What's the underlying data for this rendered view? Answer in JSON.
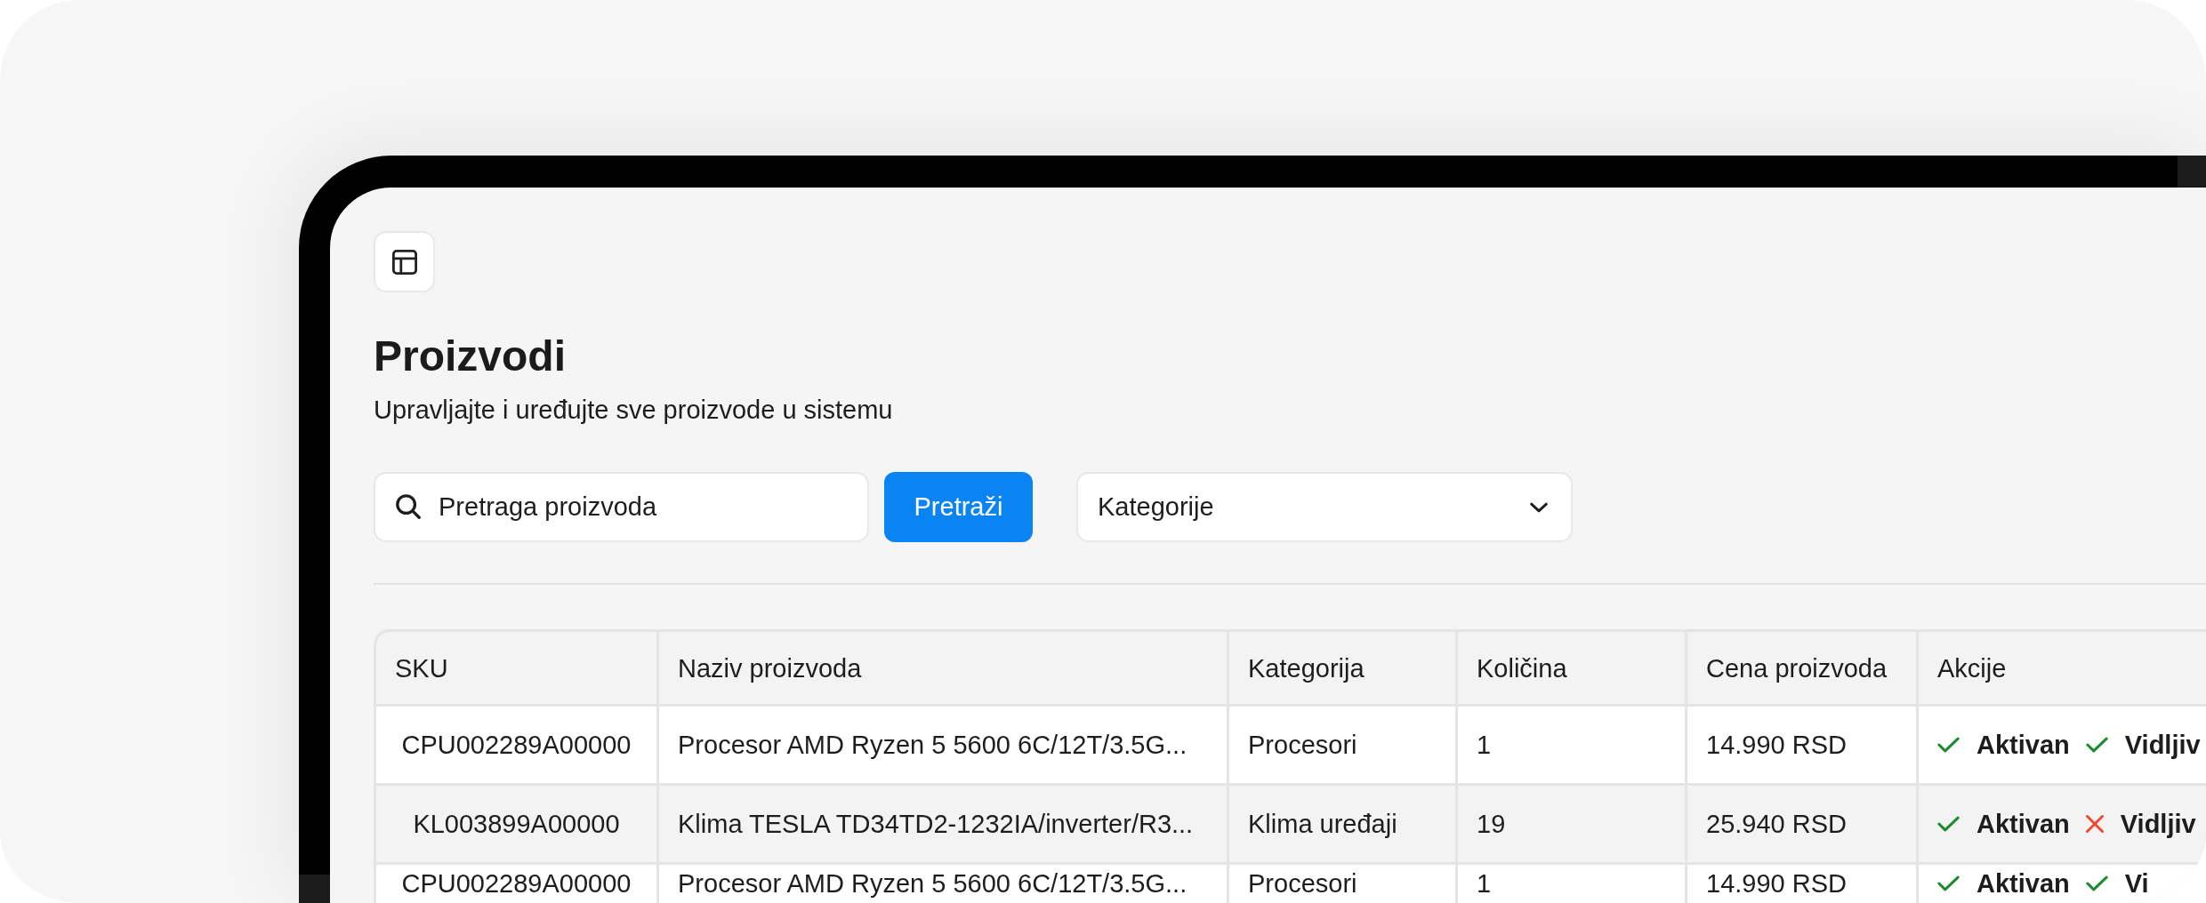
{
  "page": {
    "title": "Proizvodi",
    "subtitle": "Upravljajte i uređujte sve proizvode u sistemu"
  },
  "toolbar": {
    "search": {
      "placeholder": "Pretraga proizvoda"
    },
    "search_button": "Pretraži",
    "category_select": {
      "label": "Kategorije"
    }
  },
  "table": {
    "columns": [
      "SKU",
      "Naziv proizvoda",
      "Kategorija",
      "Količina",
      "Cena proizvoda",
      "Akcije"
    ],
    "rows": [
      {
        "sku": "CPU002289A00000",
        "name": "Procesor AMD Ryzen 5 5600 6C/12T/3.5G...",
        "category": "Procesori",
        "quantity": "1",
        "price": "14.990 RSD",
        "actions": [
          {
            "label": "Aktivan",
            "on": true
          },
          {
            "label": "Vidljiv",
            "on": true
          }
        ]
      },
      {
        "sku": "KL003899A00000",
        "name": "Klima TESLA TD34TD2-1232IA/inverter/R3...",
        "category": "Klima uređaji",
        "quantity": "19",
        "price": "25.940 RSD",
        "actions": [
          {
            "label": "Aktivan",
            "on": true
          },
          {
            "label": "Vidljiv",
            "on": false
          }
        ]
      },
      {
        "sku": "CPU002289A00000",
        "name": "Procesor AMD Ryzen 5 5600 6C/12T/3.5G...",
        "category": "Procesori",
        "quantity": "1",
        "price": "14.990 RSD",
        "actions": [
          {
            "label": "Aktivan",
            "on": true
          },
          {
            "label": "Vi",
            "on": true
          }
        ]
      }
    ]
  }
}
